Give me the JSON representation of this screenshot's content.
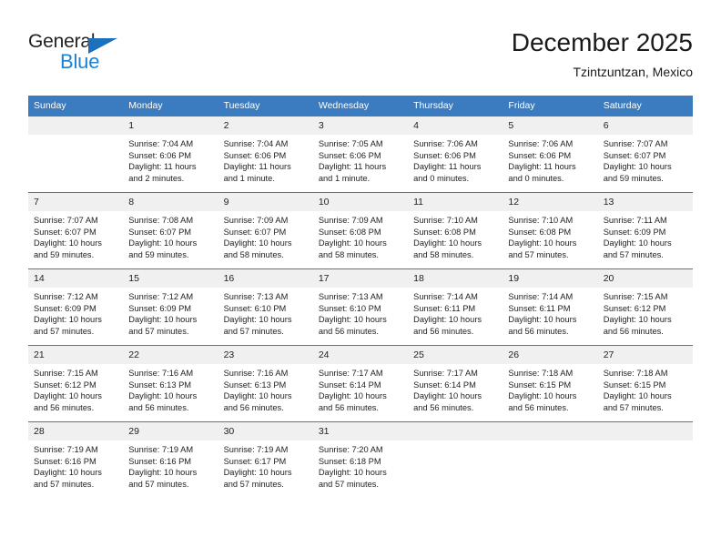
{
  "logo": {
    "word_top": "General",
    "word_bottom": "Blue",
    "triangle_color": "#1c70bd",
    "blue_color": "#1c83d4"
  },
  "header": {
    "title": "December 2025",
    "subtitle": "Tzintzuntzan, Mexico"
  },
  "theme": {
    "header_bg": "#3b7cc0",
    "daynum_bg": "#f0f0f0",
    "text": "#222222"
  },
  "weekday_headers": [
    "Sunday",
    "Monday",
    "Tuesday",
    "Wednesday",
    "Thursday",
    "Friday",
    "Saturday"
  ],
  "weeks": [
    [
      {
        "day": "",
        "sunrise": "",
        "sunset": "",
        "daylight": ""
      },
      {
        "day": "1",
        "sunrise": "Sunrise: 7:04 AM",
        "sunset": "Sunset: 6:06 PM",
        "daylight": "Daylight: 11 hours and 2 minutes."
      },
      {
        "day": "2",
        "sunrise": "Sunrise: 7:04 AM",
        "sunset": "Sunset: 6:06 PM",
        "daylight": "Daylight: 11 hours and 1 minute."
      },
      {
        "day": "3",
        "sunrise": "Sunrise: 7:05 AM",
        "sunset": "Sunset: 6:06 PM",
        "daylight": "Daylight: 11 hours and 1 minute."
      },
      {
        "day": "4",
        "sunrise": "Sunrise: 7:06 AM",
        "sunset": "Sunset: 6:06 PM",
        "daylight": "Daylight: 11 hours and 0 minutes."
      },
      {
        "day": "5",
        "sunrise": "Sunrise: 7:06 AM",
        "sunset": "Sunset: 6:06 PM",
        "daylight": "Daylight: 11 hours and 0 minutes."
      },
      {
        "day": "6",
        "sunrise": "Sunrise: 7:07 AM",
        "sunset": "Sunset: 6:07 PM",
        "daylight": "Daylight: 10 hours and 59 minutes."
      }
    ],
    [
      {
        "day": "7",
        "sunrise": "Sunrise: 7:07 AM",
        "sunset": "Sunset: 6:07 PM",
        "daylight": "Daylight: 10 hours and 59 minutes."
      },
      {
        "day": "8",
        "sunrise": "Sunrise: 7:08 AM",
        "sunset": "Sunset: 6:07 PM",
        "daylight": "Daylight: 10 hours and 59 minutes."
      },
      {
        "day": "9",
        "sunrise": "Sunrise: 7:09 AM",
        "sunset": "Sunset: 6:07 PM",
        "daylight": "Daylight: 10 hours and 58 minutes."
      },
      {
        "day": "10",
        "sunrise": "Sunrise: 7:09 AM",
        "sunset": "Sunset: 6:08 PM",
        "daylight": "Daylight: 10 hours and 58 minutes."
      },
      {
        "day": "11",
        "sunrise": "Sunrise: 7:10 AM",
        "sunset": "Sunset: 6:08 PM",
        "daylight": "Daylight: 10 hours and 58 minutes."
      },
      {
        "day": "12",
        "sunrise": "Sunrise: 7:10 AM",
        "sunset": "Sunset: 6:08 PM",
        "daylight": "Daylight: 10 hours and 57 minutes."
      },
      {
        "day": "13",
        "sunrise": "Sunrise: 7:11 AM",
        "sunset": "Sunset: 6:09 PM",
        "daylight": "Daylight: 10 hours and 57 minutes."
      }
    ],
    [
      {
        "day": "14",
        "sunrise": "Sunrise: 7:12 AM",
        "sunset": "Sunset: 6:09 PM",
        "daylight": "Daylight: 10 hours and 57 minutes."
      },
      {
        "day": "15",
        "sunrise": "Sunrise: 7:12 AM",
        "sunset": "Sunset: 6:09 PM",
        "daylight": "Daylight: 10 hours and 57 minutes."
      },
      {
        "day": "16",
        "sunrise": "Sunrise: 7:13 AM",
        "sunset": "Sunset: 6:10 PM",
        "daylight": "Daylight: 10 hours and 57 minutes."
      },
      {
        "day": "17",
        "sunrise": "Sunrise: 7:13 AM",
        "sunset": "Sunset: 6:10 PM",
        "daylight": "Daylight: 10 hours and 56 minutes."
      },
      {
        "day": "18",
        "sunrise": "Sunrise: 7:14 AM",
        "sunset": "Sunset: 6:11 PM",
        "daylight": "Daylight: 10 hours and 56 minutes."
      },
      {
        "day": "19",
        "sunrise": "Sunrise: 7:14 AM",
        "sunset": "Sunset: 6:11 PM",
        "daylight": "Daylight: 10 hours and 56 minutes."
      },
      {
        "day": "20",
        "sunrise": "Sunrise: 7:15 AM",
        "sunset": "Sunset: 6:12 PM",
        "daylight": "Daylight: 10 hours and 56 minutes."
      }
    ],
    [
      {
        "day": "21",
        "sunrise": "Sunrise: 7:15 AM",
        "sunset": "Sunset: 6:12 PM",
        "daylight": "Daylight: 10 hours and 56 minutes."
      },
      {
        "day": "22",
        "sunrise": "Sunrise: 7:16 AM",
        "sunset": "Sunset: 6:13 PM",
        "daylight": "Daylight: 10 hours and 56 minutes."
      },
      {
        "day": "23",
        "sunrise": "Sunrise: 7:16 AM",
        "sunset": "Sunset: 6:13 PM",
        "daylight": "Daylight: 10 hours and 56 minutes."
      },
      {
        "day": "24",
        "sunrise": "Sunrise: 7:17 AM",
        "sunset": "Sunset: 6:14 PM",
        "daylight": "Daylight: 10 hours and 56 minutes."
      },
      {
        "day": "25",
        "sunrise": "Sunrise: 7:17 AM",
        "sunset": "Sunset: 6:14 PM",
        "daylight": "Daylight: 10 hours and 56 minutes."
      },
      {
        "day": "26",
        "sunrise": "Sunrise: 7:18 AM",
        "sunset": "Sunset: 6:15 PM",
        "daylight": "Daylight: 10 hours and 56 minutes."
      },
      {
        "day": "27",
        "sunrise": "Sunrise: 7:18 AM",
        "sunset": "Sunset: 6:15 PM",
        "daylight": "Daylight: 10 hours and 57 minutes."
      }
    ],
    [
      {
        "day": "28",
        "sunrise": "Sunrise: 7:19 AM",
        "sunset": "Sunset: 6:16 PM",
        "daylight": "Daylight: 10 hours and 57 minutes."
      },
      {
        "day": "29",
        "sunrise": "Sunrise: 7:19 AM",
        "sunset": "Sunset: 6:16 PM",
        "daylight": "Daylight: 10 hours and 57 minutes."
      },
      {
        "day": "30",
        "sunrise": "Sunrise: 7:19 AM",
        "sunset": "Sunset: 6:17 PM",
        "daylight": "Daylight: 10 hours and 57 minutes."
      },
      {
        "day": "31",
        "sunrise": "Sunrise: 7:20 AM",
        "sunset": "Sunset: 6:18 PM",
        "daylight": "Daylight: 10 hours and 57 minutes."
      },
      {
        "day": "",
        "sunrise": "",
        "sunset": "",
        "daylight": ""
      },
      {
        "day": "",
        "sunrise": "",
        "sunset": "",
        "daylight": ""
      },
      {
        "day": "",
        "sunrise": "",
        "sunset": "",
        "daylight": ""
      }
    ]
  ]
}
